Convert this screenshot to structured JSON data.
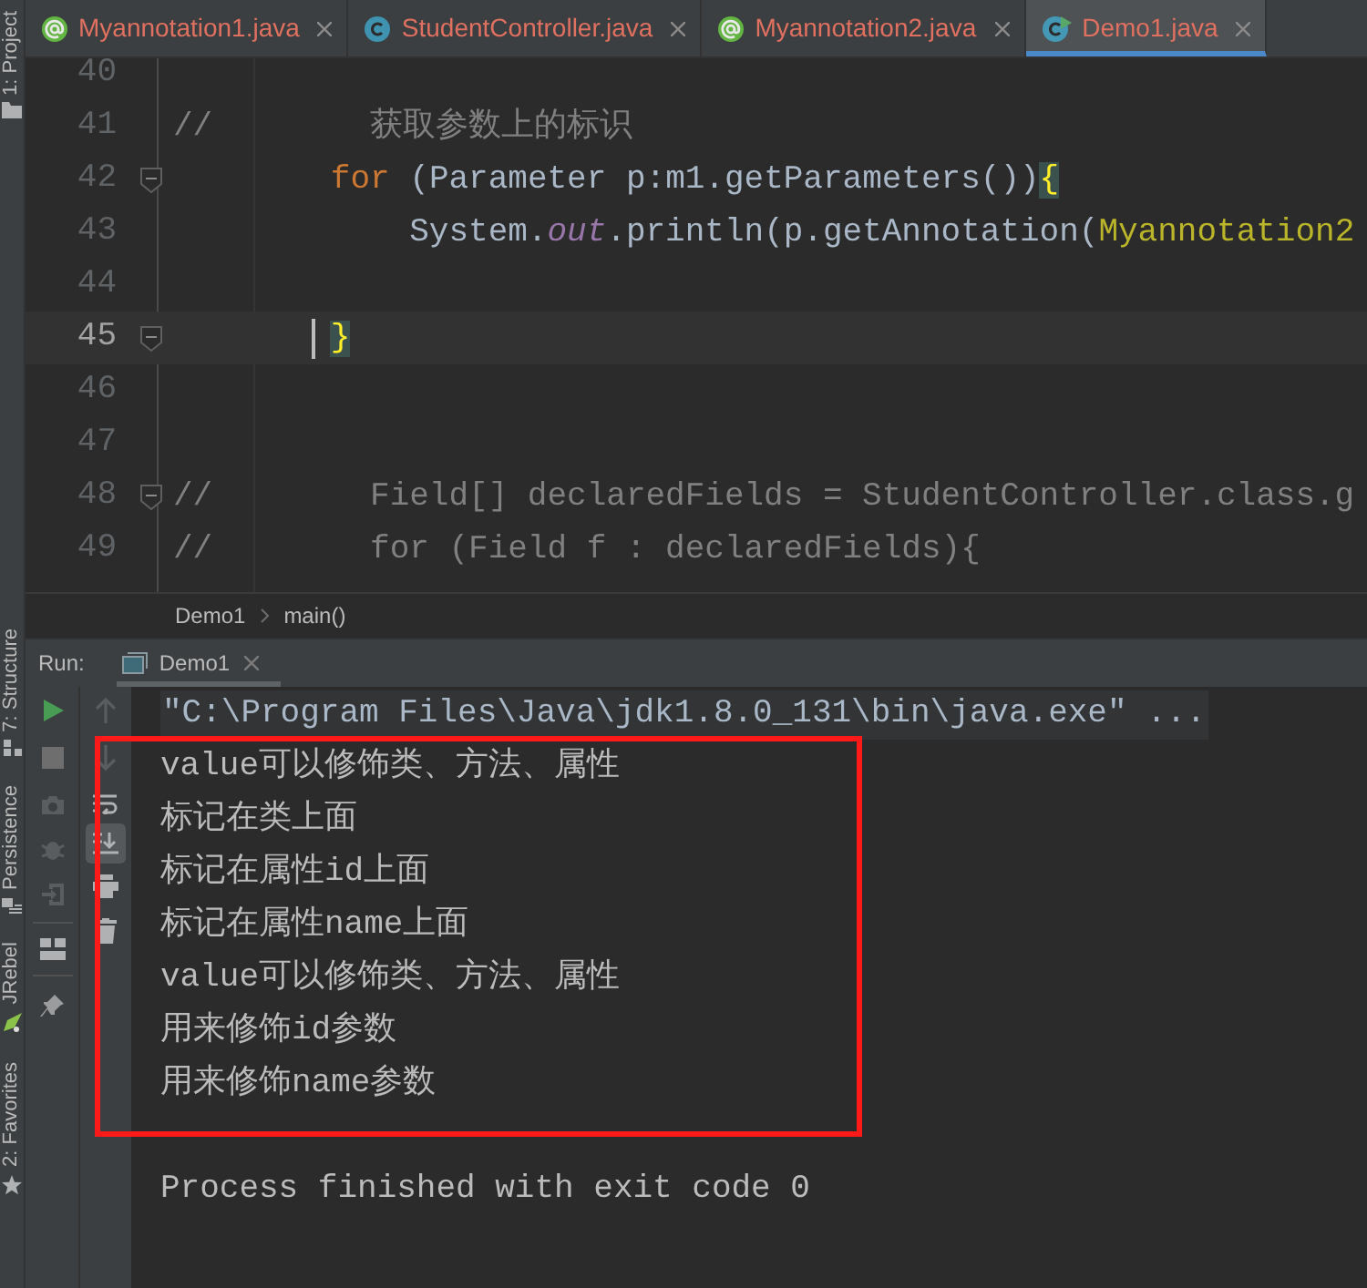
{
  "tool_strip": [
    {
      "label": "1: Project",
      "kind": "project"
    },
    {
      "label": "7: Structure",
      "kind": "structure"
    },
    {
      "label": "Persistence",
      "kind": "persistence"
    },
    {
      "label": "JRebel",
      "kind": "jrebel"
    },
    {
      "label": "2: Favorites",
      "kind": "favorites"
    }
  ],
  "tabs": [
    {
      "label": "Myannotation1.java",
      "kind": "annotation",
      "selected": false
    },
    {
      "label": "StudentController.java",
      "kind": "class",
      "selected": false
    },
    {
      "label": "Myannotation2.java",
      "kind": "annotation",
      "selected": false
    },
    {
      "label": "Demo1.java",
      "kind": "runnable_class",
      "selected": true
    }
  ],
  "editor": {
    "lines": [
      {
        "number": "40",
        "current": false,
        "fold": false
      },
      {
        "number": "41",
        "current": false,
        "fold": false,
        "segments": [
          {
            "kind": "comment",
            "text": "//        获取参数上的标识"
          }
        ]
      },
      {
        "number": "42",
        "current": false,
        "fold": true,
        "segments": [
          {
            "kind": "keyword",
            "text": "        for"
          },
          {
            "kind": "plain",
            "text": " (Parameter p:m1.getParameters())"
          },
          {
            "kind": "brace",
            "text": "{"
          }
        ]
      },
      {
        "number": "43",
        "current": false,
        "fold": false,
        "segments": [
          {
            "kind": "plain",
            "text": "            System."
          },
          {
            "kind": "static",
            "text": "out"
          },
          {
            "kind": "plain",
            "text": ".println(p.getAnnotation("
          },
          {
            "kind": "class_ref",
            "text": "Myannotation2"
          }
        ]
      },
      {
        "number": "44",
        "current": false,
        "fold": false
      },
      {
        "number": "45",
        "current": true,
        "fold": true,
        "segments": [
          {
            "kind": "brace",
            "text": "        }"
          }
        ]
      },
      {
        "number": "46",
        "current": false,
        "fold": false
      },
      {
        "number": "47",
        "current": false,
        "fold": false
      },
      {
        "number": "48",
        "current": false,
        "fold": true,
        "segments": [
          {
            "kind": "comment",
            "text": "//        Field[] declaredFields = StudentController.class.g"
          }
        ]
      },
      {
        "number": "49",
        "current": false,
        "fold": false,
        "segments": [
          {
            "kind": "comment",
            "text": "//        for (Field f : declaredFields){"
          }
        ]
      }
    ]
  },
  "breadcrumbs": [
    "Demo1",
    "main()"
  ],
  "run_panel": {
    "label": "Run:",
    "tab": "Demo1",
    "scroll_to_end_active": true
  },
  "console": {
    "lines_before": [
      {
        "kind": "command",
        "text": "\"C:\\Program Files\\Java\\jdk1.8.0_131\\bin\\java.exe\" ..."
      }
    ],
    "highlighted_lines": [
      {
        "kind": "output",
        "text": "value可以修饰类、方法、属性"
      },
      {
        "kind": "output",
        "text": "标记在类上面"
      },
      {
        "kind": "output",
        "text": "标记在属性id上面"
      },
      {
        "kind": "output",
        "text": "标记在属性name上面"
      },
      {
        "kind": "output",
        "text": "value可以修饰类、方法、属性"
      },
      {
        "kind": "output",
        "text": "用来修饰id参数"
      },
      {
        "kind": "output",
        "text": "用来修饰name参数"
      }
    ],
    "lines_after": [
      {
        "kind": "blank"
      },
      {
        "kind": "output",
        "text": "Process finished with exit code 0"
      }
    ]
  }
}
